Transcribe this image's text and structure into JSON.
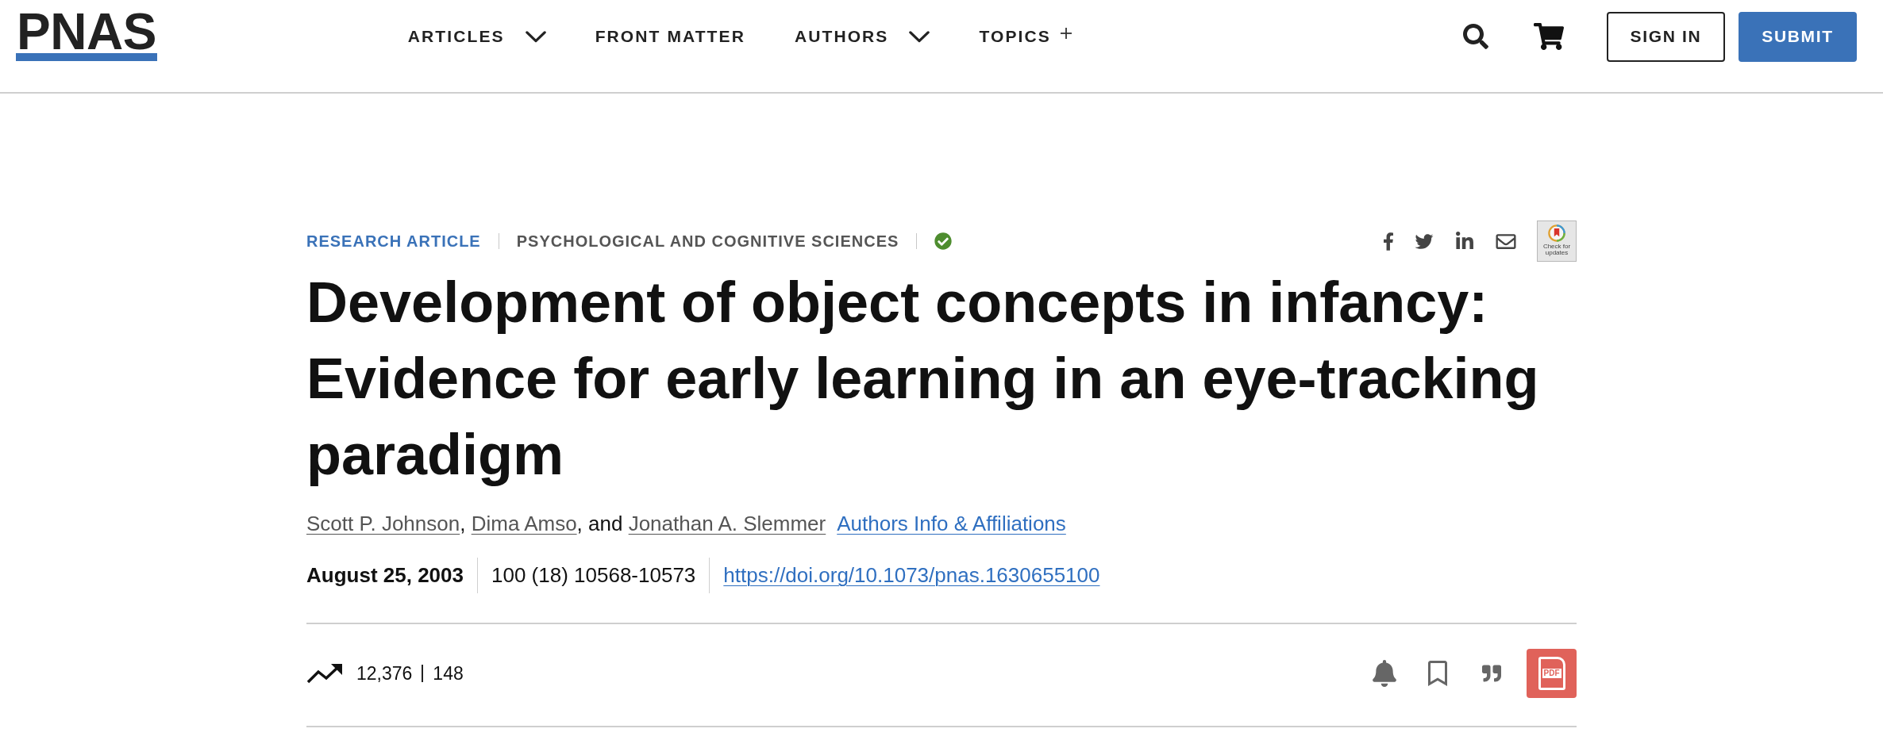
{
  "header": {
    "logo": "PNAS",
    "nav": [
      {
        "label": "ARTICLES",
        "kind": "dropdown"
      },
      {
        "label": "FRONT MATTER",
        "kind": "plain"
      },
      {
        "label": "AUTHORS",
        "kind": "dropdown"
      },
      {
        "label": "TOPICS",
        "kind": "expand"
      }
    ],
    "buttons": [
      {
        "label": "SIGN IN",
        "kind": "outline"
      },
      {
        "label": "SUBMIT",
        "kind": "primary"
      }
    ]
  },
  "article": {
    "type": "RESEARCH ARTICLE",
    "subject": "PSYCHOLOGICAL AND COGNITIVE SCIENCES",
    "verified": true,
    "updates_badge": "Check for updates",
    "title": "Development of object concepts in infancy: Evidence for early learning in an eye-tracking paradigm",
    "authors": [
      {
        "name": "Scott P. Johnson",
        "after": ", "
      },
      {
        "name": "Dima Amso",
        "after": ", and "
      },
      {
        "name": "Jonathan A. Slemmer"
      }
    ],
    "affiliations_link": "Authors Info & Affiliations",
    "date": "August 25, 2003",
    "citation": "100 (18) 10568-10573",
    "doi": "https://doi.org/10.1073/pnas.1630655100"
  },
  "metrics": {
    "views": "12,376",
    "citations": "148"
  },
  "actions": {
    "pdf_label": "PDF"
  }
}
